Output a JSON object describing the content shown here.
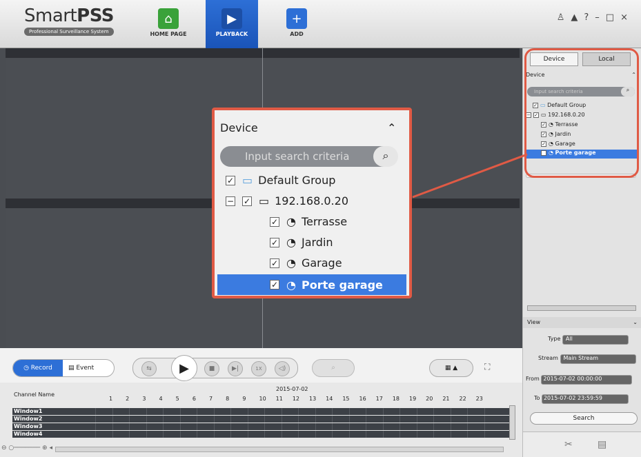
{
  "app": {
    "name_regular": "Smart",
    "name_bold": "PSS",
    "subtitle": "Professional Surveillance System"
  },
  "nav": [
    {
      "label": "HOME PAGE",
      "icon": "home-icon"
    },
    {
      "label": "PLAYBACK",
      "icon": "playback-icon"
    },
    {
      "label": "ADD",
      "icon": "plus-icon"
    }
  ],
  "window_controls": [
    "user-icon",
    "lock-icon",
    "help-icon",
    "minimize-icon",
    "maximize-icon",
    "close-icon"
  ],
  "toolbar": {
    "record_label": "Record",
    "event_label": "Event",
    "speed_label": "1X"
  },
  "timeline": {
    "channel_header": "Channel Name",
    "date": "2015-07-02",
    "hours": [
      "1",
      "2",
      "3",
      "4",
      "5",
      "6",
      "7",
      "8",
      "9",
      "10",
      "11",
      "12",
      "13",
      "14",
      "15",
      "16",
      "17",
      "18",
      "19",
      "20",
      "21",
      "22",
      "23"
    ],
    "windows": [
      "Window1",
      "Window2",
      "Window3",
      "Window4"
    ]
  },
  "right_panel": {
    "tab_device": "Device",
    "tab_local": "Local",
    "device_header": "Device",
    "search_placeholder": "Input search criteria",
    "tree": {
      "group": "Default Group",
      "device": "192.168.0.20",
      "channels": [
        "Terrasse",
        "Jardin",
        "Garage",
        "Porte garage"
      ],
      "selected": "Porte garage"
    },
    "view_header": "View",
    "type_label": "Type",
    "type_value": "All",
    "stream_label": "Stream",
    "stream_value": "Main Stream",
    "from_label": "From",
    "from_value": "2015-07-02 00:00:00",
    "to_label": "To",
    "to_value": "2015-07-02 23:59:59",
    "search_button": "Search"
  },
  "colors": {
    "accent": "#2d6fd6",
    "highlight": "#e05a45",
    "selection": "#3b7be0"
  }
}
